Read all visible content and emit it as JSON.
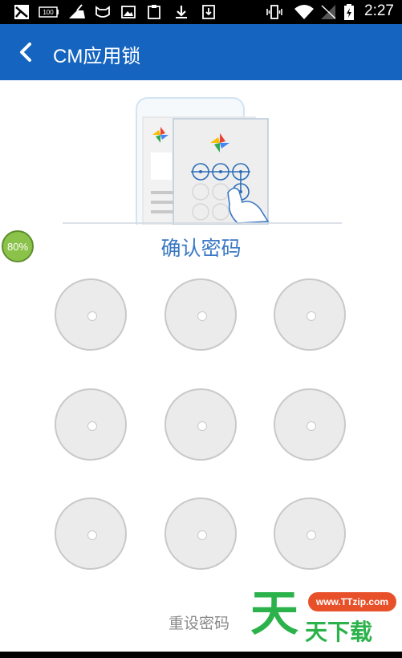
{
  "statusbar": {
    "time": "2:27",
    "icons": [
      "app-notification-icon",
      "battery-100-icon",
      "cleaner-icon",
      "cat-icon",
      "image-icon",
      "clipboard-icon",
      "download-icon",
      "download-box-icon",
      "vibrate-icon",
      "wifi-icon",
      "no-signal-icon",
      "charging-battery-icon"
    ],
    "battery_label": "100"
  },
  "appbar": {
    "title": "CM应用锁",
    "background": "#1565c0"
  },
  "overlay_badge": "80%",
  "confirm_label": "确认密码",
  "pattern_dots": 9,
  "reset_label": "重设密码",
  "watermark": {
    "url": "www.TTzip.com",
    "big_char": "天",
    "brand": "天下载",
    "color": "#2bb24a"
  },
  "accent_color": "#3a78c4"
}
